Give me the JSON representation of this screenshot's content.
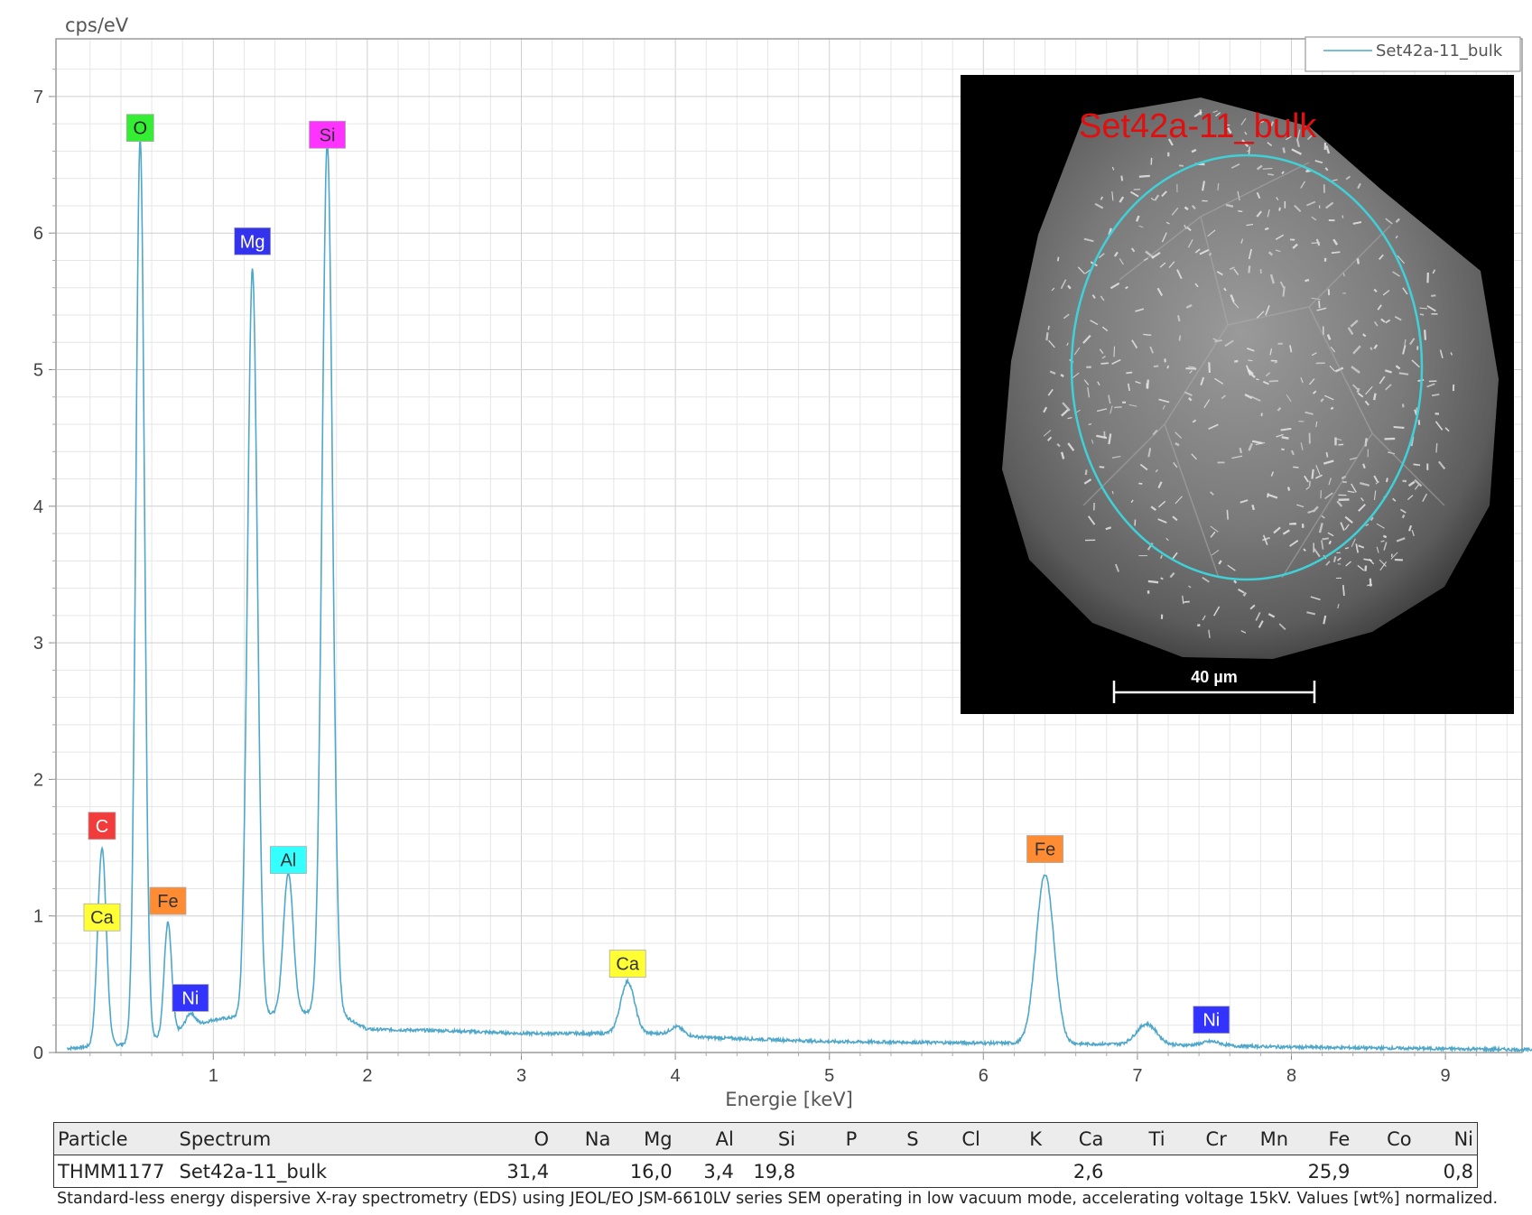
{
  "chart_data": {
    "type": "line",
    "ylabel": "cps/eV",
    "xlabel": "Energie [keV]",
    "xlim": [
      0.05,
      9.6
    ],
    "ylim": [
      0,
      7.4
    ],
    "x_ticks": [
      1,
      2,
      3,
      4,
      5,
      6,
      7,
      8,
      9
    ],
    "y_ticks": [
      0,
      1,
      2,
      3,
      4,
      5,
      6,
      7
    ],
    "grid": true,
    "legend_position": "top-right",
    "series": [
      {
        "name": "Set42a-11_bulk",
        "color": "#4fa7c9",
        "baseline": [
          [
            0.05,
            0.03
          ],
          [
            0.4,
            0.06
          ],
          [
            0.6,
            0.09
          ],
          [
            0.8,
            0.17
          ],
          [
            1.0,
            0.24
          ],
          [
            1.3,
            0.28
          ],
          [
            1.8,
            0.3
          ],
          [
            2.0,
            0.17
          ],
          [
            2.5,
            0.16
          ],
          [
            3.0,
            0.14
          ],
          [
            3.5,
            0.14
          ],
          [
            3.9,
            0.14
          ],
          [
            4.2,
            0.11
          ],
          [
            5.0,
            0.08
          ],
          [
            6.0,
            0.07
          ],
          [
            7.0,
            0.06
          ],
          [
            8.0,
            0.04
          ],
          [
            9.6,
            0.02
          ]
        ],
        "peaks": [
          {
            "center": 0.277,
            "height": 1.45,
            "width": 0.028
          },
          {
            "center": 0.525,
            "height": 6.62,
            "width": 0.028
          },
          {
            "center": 0.705,
            "height": 0.82,
            "width": 0.024
          },
          {
            "center": 0.851,
            "height": 0.1,
            "width": 0.03
          },
          {
            "center": 1.254,
            "height": 5.47,
            "width": 0.032
          },
          {
            "center": 1.487,
            "height": 1.03,
            "width": 0.032
          },
          {
            "center": 1.74,
            "height": 6.36,
            "width": 0.034
          },
          {
            "center": 3.69,
            "height": 0.38,
            "width": 0.045
          },
          {
            "center": 4.01,
            "height": 0.06,
            "width": 0.04
          },
          {
            "center": 6.4,
            "height": 1.24,
            "width": 0.058
          },
          {
            "center": 7.06,
            "height": 0.15,
            "width": 0.065
          },
          {
            "center": 7.48,
            "height": 0.03,
            "width": 0.06
          }
        ]
      }
    ],
    "peak_labels": [
      {
        "text": "C",
        "x": 0.277,
        "y": 1.66,
        "bg": "#f23c3c",
        "fg": "#ffffff"
      },
      {
        "text": "Ca",
        "x": 0.277,
        "y": 0.99,
        "bg": "#ffff33",
        "fg": "#333333"
      },
      {
        "text": "O",
        "x": 0.525,
        "y": 6.77,
        "bg": "#33ee33",
        "fg": "#222222"
      },
      {
        "text": "Fe",
        "x": 0.705,
        "y": 1.11,
        "bg": "#ff8c33",
        "fg": "#333333"
      },
      {
        "text": "Ni",
        "x": 0.851,
        "y": 0.4,
        "bg": "#3333ff",
        "fg": "#ffffff"
      },
      {
        "text": "Mg",
        "x": 1.254,
        "y": 5.94,
        "bg": "#3333ee",
        "fg": "#ffffff"
      },
      {
        "text": "Al",
        "x": 1.487,
        "y": 1.41,
        "bg": "#33ffff",
        "fg": "#333333"
      },
      {
        "text": "Si",
        "x": 1.74,
        "y": 6.72,
        "bg": "#ff33ff",
        "fg": "#333333"
      },
      {
        "text": "Ca",
        "x": 3.69,
        "y": 0.65,
        "bg": "#ffff33",
        "fg": "#333333"
      },
      {
        "text": "Fe",
        "x": 6.4,
        "y": 1.49,
        "bg": "#ff8c33",
        "fg": "#333333"
      },
      {
        "text": "Ni",
        "x": 7.48,
        "y": 0.24,
        "bg": "#3333ff",
        "fg": "#ffffff"
      }
    ]
  },
  "inset": {
    "label": "Set42a-11_bulk",
    "scale_bar": "40 µm"
  },
  "table": {
    "headers": [
      "Particle",
      "Spectrum",
      "O",
      "Na",
      "Mg",
      "Al",
      "Si",
      "P",
      "S",
      "Cl",
      "K",
      "Ca",
      "Ti",
      "Cr",
      "Mn",
      "Fe",
      "Co",
      "Ni"
    ],
    "rows": [
      [
        "THMM1177",
        "Set42a-11_bulk",
        "31,4",
        "",
        "16,0",
        "3,4",
        "19,8",
        "",
        "",
        "",
        "",
        "2,6",
        "",
        "",
        "",
        "25,9",
        "",
        "0,8"
      ]
    ]
  },
  "footnote": "Standard-less energy dispersive X-ray spectrometry (EDS) using JEOL/EO JSM-6610LV series SEM operating in low vacuum mode, accelerating voltage 15kV. Values [wt%] normalized."
}
